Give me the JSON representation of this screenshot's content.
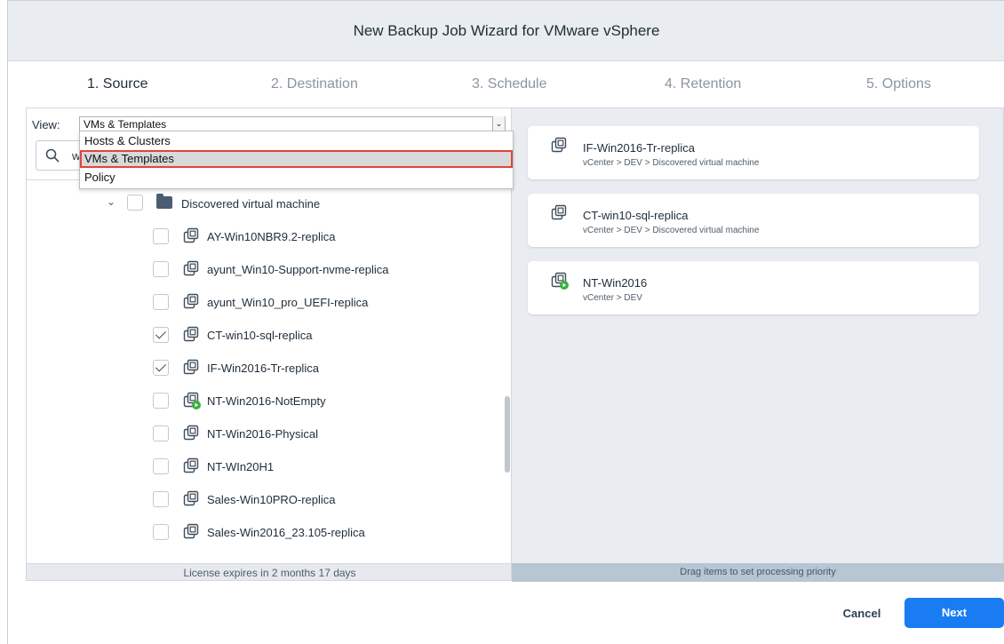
{
  "window": {
    "title": "New Backup Job Wizard for VMware vSphere"
  },
  "steps": [
    {
      "label": "1. Source",
      "active": true
    },
    {
      "label": "2. Destination",
      "active": false
    },
    {
      "label": "3. Schedule",
      "active": false
    },
    {
      "label": "4. Retention",
      "active": false
    },
    {
      "label": "5. Options",
      "active": false
    }
  ],
  "view": {
    "label": "View:",
    "selected": "VMs & Templates",
    "options": [
      "Hosts & Clusters",
      "VMs & Templates",
      "Policy"
    ]
  },
  "search": {
    "value": "w"
  },
  "tree": {
    "folder": {
      "label": "Discovered virtual machine",
      "checked": false
    },
    "items": [
      {
        "label": "AY-Win10NBR9.2-replica",
        "checked": false,
        "running": false
      },
      {
        "label": "ayunt_Win10-Support-nvme-replica",
        "checked": false,
        "running": false
      },
      {
        "label": "ayunt_Win10_pro_UEFI-replica",
        "checked": false,
        "running": false
      },
      {
        "label": "CT-win10-sql-replica",
        "checked": true,
        "running": false
      },
      {
        "label": "IF-Win2016-Tr-replica",
        "checked": true,
        "running": false
      },
      {
        "label": "NT-Win2016-NotEmpty",
        "checked": false,
        "running": true
      },
      {
        "label": "NT-Win2016-Physical",
        "checked": false,
        "running": false
      },
      {
        "label": "NT-WIn20H1",
        "checked": false,
        "running": false
      },
      {
        "label": "Sales-Win10PRO-replica",
        "checked": false,
        "running": false
      },
      {
        "label": "Sales-Win2016_23.105-replica",
        "checked": false,
        "running": false
      }
    ]
  },
  "left_footer": "License expires in 2 months 17 days",
  "selected_cards": [
    {
      "title": "IF-Win2016-Tr-replica",
      "path": "vCenter > DEV > Discovered virtual machine",
      "running": false
    },
    {
      "title": "CT-win10-sql-replica",
      "path": "vCenter > DEV > Discovered virtual machine",
      "running": false
    },
    {
      "title": "NT-Win2016",
      "path": "vCenter > DEV",
      "running": true
    }
  ],
  "right_footer": "Drag items to set processing priority",
  "buttons": {
    "cancel": "Cancel",
    "next": "Next"
  },
  "colors": {
    "accent": "#1a7cf2",
    "highlight": "#e0443a",
    "running": "#3cb043"
  }
}
